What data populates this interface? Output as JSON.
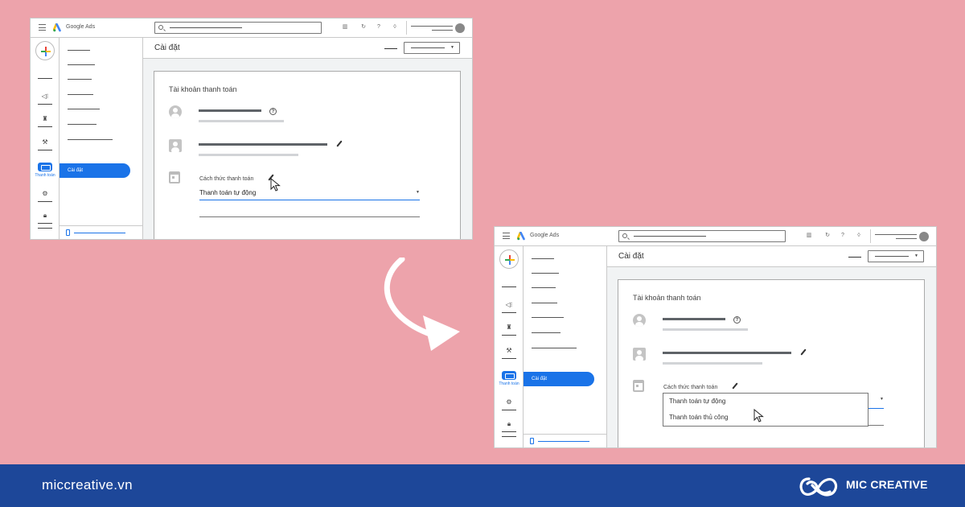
{
  "app": {
    "brand": "Google Ads"
  },
  "nav": {
    "billing_label": "Thanh toán",
    "active_subnav": "Cài đặt"
  },
  "page": {
    "title": "Cài đặt"
  },
  "billing_card": {
    "title": "Tài khoản thanh toán",
    "method_label": "Cách thức thanh toán",
    "method_value": "Thanh toán tự động"
  },
  "dropdown": {
    "options": [
      "Thanh toán tự động",
      "Thanh toán thủ công"
    ]
  },
  "footer": {
    "website": "miccreative.vn",
    "brand": "MIC CREATIVE"
  },
  "colors": {
    "background": "#eda3ab",
    "footer": "#1d4799",
    "accent": "#1a73e8"
  }
}
